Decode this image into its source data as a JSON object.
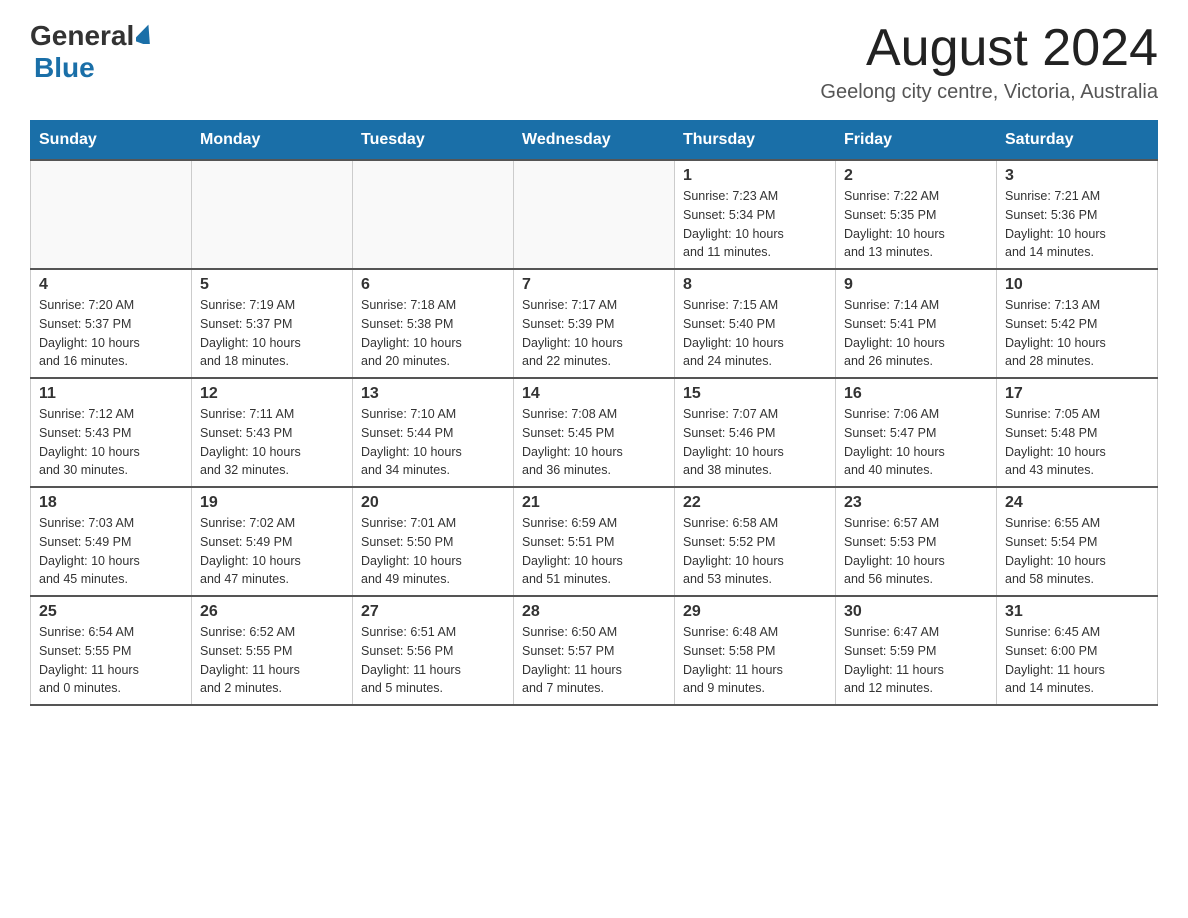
{
  "header": {
    "logo_general": "General",
    "logo_blue": "Blue",
    "month_title": "August 2024",
    "location": "Geelong city centre, Victoria, Australia"
  },
  "days_of_week": [
    "Sunday",
    "Monday",
    "Tuesday",
    "Wednesday",
    "Thursday",
    "Friday",
    "Saturday"
  ],
  "weeks": [
    [
      {
        "day": "",
        "info": ""
      },
      {
        "day": "",
        "info": ""
      },
      {
        "day": "",
        "info": ""
      },
      {
        "day": "",
        "info": ""
      },
      {
        "day": "1",
        "info": "Sunrise: 7:23 AM\nSunset: 5:34 PM\nDaylight: 10 hours\nand 11 minutes."
      },
      {
        "day": "2",
        "info": "Sunrise: 7:22 AM\nSunset: 5:35 PM\nDaylight: 10 hours\nand 13 minutes."
      },
      {
        "day": "3",
        "info": "Sunrise: 7:21 AM\nSunset: 5:36 PM\nDaylight: 10 hours\nand 14 minutes."
      }
    ],
    [
      {
        "day": "4",
        "info": "Sunrise: 7:20 AM\nSunset: 5:37 PM\nDaylight: 10 hours\nand 16 minutes."
      },
      {
        "day": "5",
        "info": "Sunrise: 7:19 AM\nSunset: 5:37 PM\nDaylight: 10 hours\nand 18 minutes."
      },
      {
        "day": "6",
        "info": "Sunrise: 7:18 AM\nSunset: 5:38 PM\nDaylight: 10 hours\nand 20 minutes."
      },
      {
        "day": "7",
        "info": "Sunrise: 7:17 AM\nSunset: 5:39 PM\nDaylight: 10 hours\nand 22 minutes."
      },
      {
        "day": "8",
        "info": "Sunrise: 7:15 AM\nSunset: 5:40 PM\nDaylight: 10 hours\nand 24 minutes."
      },
      {
        "day": "9",
        "info": "Sunrise: 7:14 AM\nSunset: 5:41 PM\nDaylight: 10 hours\nand 26 minutes."
      },
      {
        "day": "10",
        "info": "Sunrise: 7:13 AM\nSunset: 5:42 PM\nDaylight: 10 hours\nand 28 minutes."
      }
    ],
    [
      {
        "day": "11",
        "info": "Sunrise: 7:12 AM\nSunset: 5:43 PM\nDaylight: 10 hours\nand 30 minutes."
      },
      {
        "day": "12",
        "info": "Sunrise: 7:11 AM\nSunset: 5:43 PM\nDaylight: 10 hours\nand 32 minutes."
      },
      {
        "day": "13",
        "info": "Sunrise: 7:10 AM\nSunset: 5:44 PM\nDaylight: 10 hours\nand 34 minutes."
      },
      {
        "day": "14",
        "info": "Sunrise: 7:08 AM\nSunset: 5:45 PM\nDaylight: 10 hours\nand 36 minutes."
      },
      {
        "day": "15",
        "info": "Sunrise: 7:07 AM\nSunset: 5:46 PM\nDaylight: 10 hours\nand 38 minutes."
      },
      {
        "day": "16",
        "info": "Sunrise: 7:06 AM\nSunset: 5:47 PM\nDaylight: 10 hours\nand 40 minutes."
      },
      {
        "day": "17",
        "info": "Sunrise: 7:05 AM\nSunset: 5:48 PM\nDaylight: 10 hours\nand 43 minutes."
      }
    ],
    [
      {
        "day": "18",
        "info": "Sunrise: 7:03 AM\nSunset: 5:49 PM\nDaylight: 10 hours\nand 45 minutes."
      },
      {
        "day": "19",
        "info": "Sunrise: 7:02 AM\nSunset: 5:49 PM\nDaylight: 10 hours\nand 47 minutes."
      },
      {
        "day": "20",
        "info": "Sunrise: 7:01 AM\nSunset: 5:50 PM\nDaylight: 10 hours\nand 49 minutes."
      },
      {
        "day": "21",
        "info": "Sunrise: 6:59 AM\nSunset: 5:51 PM\nDaylight: 10 hours\nand 51 minutes."
      },
      {
        "day": "22",
        "info": "Sunrise: 6:58 AM\nSunset: 5:52 PM\nDaylight: 10 hours\nand 53 minutes."
      },
      {
        "day": "23",
        "info": "Sunrise: 6:57 AM\nSunset: 5:53 PM\nDaylight: 10 hours\nand 56 minutes."
      },
      {
        "day": "24",
        "info": "Sunrise: 6:55 AM\nSunset: 5:54 PM\nDaylight: 10 hours\nand 58 minutes."
      }
    ],
    [
      {
        "day": "25",
        "info": "Sunrise: 6:54 AM\nSunset: 5:55 PM\nDaylight: 11 hours\nand 0 minutes."
      },
      {
        "day": "26",
        "info": "Sunrise: 6:52 AM\nSunset: 5:55 PM\nDaylight: 11 hours\nand 2 minutes."
      },
      {
        "day": "27",
        "info": "Sunrise: 6:51 AM\nSunset: 5:56 PM\nDaylight: 11 hours\nand 5 minutes."
      },
      {
        "day": "28",
        "info": "Sunrise: 6:50 AM\nSunset: 5:57 PM\nDaylight: 11 hours\nand 7 minutes."
      },
      {
        "day": "29",
        "info": "Sunrise: 6:48 AM\nSunset: 5:58 PM\nDaylight: 11 hours\nand 9 minutes."
      },
      {
        "day": "30",
        "info": "Sunrise: 6:47 AM\nSunset: 5:59 PM\nDaylight: 11 hours\nand 12 minutes."
      },
      {
        "day": "31",
        "info": "Sunrise: 6:45 AM\nSunset: 6:00 PM\nDaylight: 11 hours\nand 14 minutes."
      }
    ]
  ]
}
